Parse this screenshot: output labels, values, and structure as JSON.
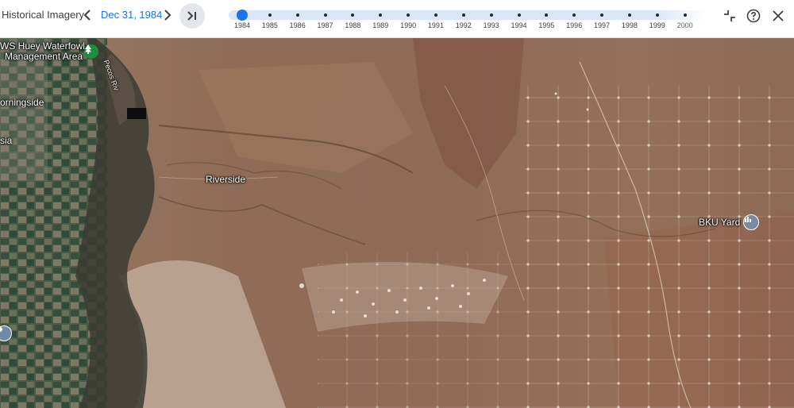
{
  "toolbar": {
    "title": "Historical Imagery",
    "date": "Dec 31, 1984",
    "prev_icon": "chevron-left-icon",
    "next_icon": "chevron-right-icon",
    "jump_icon": "skip-to-end-icon",
    "exit_fullscreen_icon": "collapse-icon",
    "help_icon": "help-icon",
    "close_icon": "close-icon"
  },
  "timeline": {
    "years": [
      "1984",
      "1985",
      "1986",
      "1987",
      "1988",
      "1989",
      "1990",
      "1991",
      "1992",
      "1993",
      "1994",
      "1995",
      "1996",
      "1997",
      "1998",
      "1999",
      "2000"
    ],
    "selected": "1984",
    "accent": "#1a73e8"
  },
  "map": {
    "labels": {
      "huey_line1": "WS Huey Waterfowl",
      "huey_line2": "Management Area",
      "morningside": "orningside",
      "sia": "sia",
      "riverside": "Riverside",
      "bku_yard": "BKU Yard",
      "road": "Pecos Riv"
    },
    "poi_icons": [
      "tree-icon",
      "industrial-icon",
      "place-icon"
    ]
  }
}
